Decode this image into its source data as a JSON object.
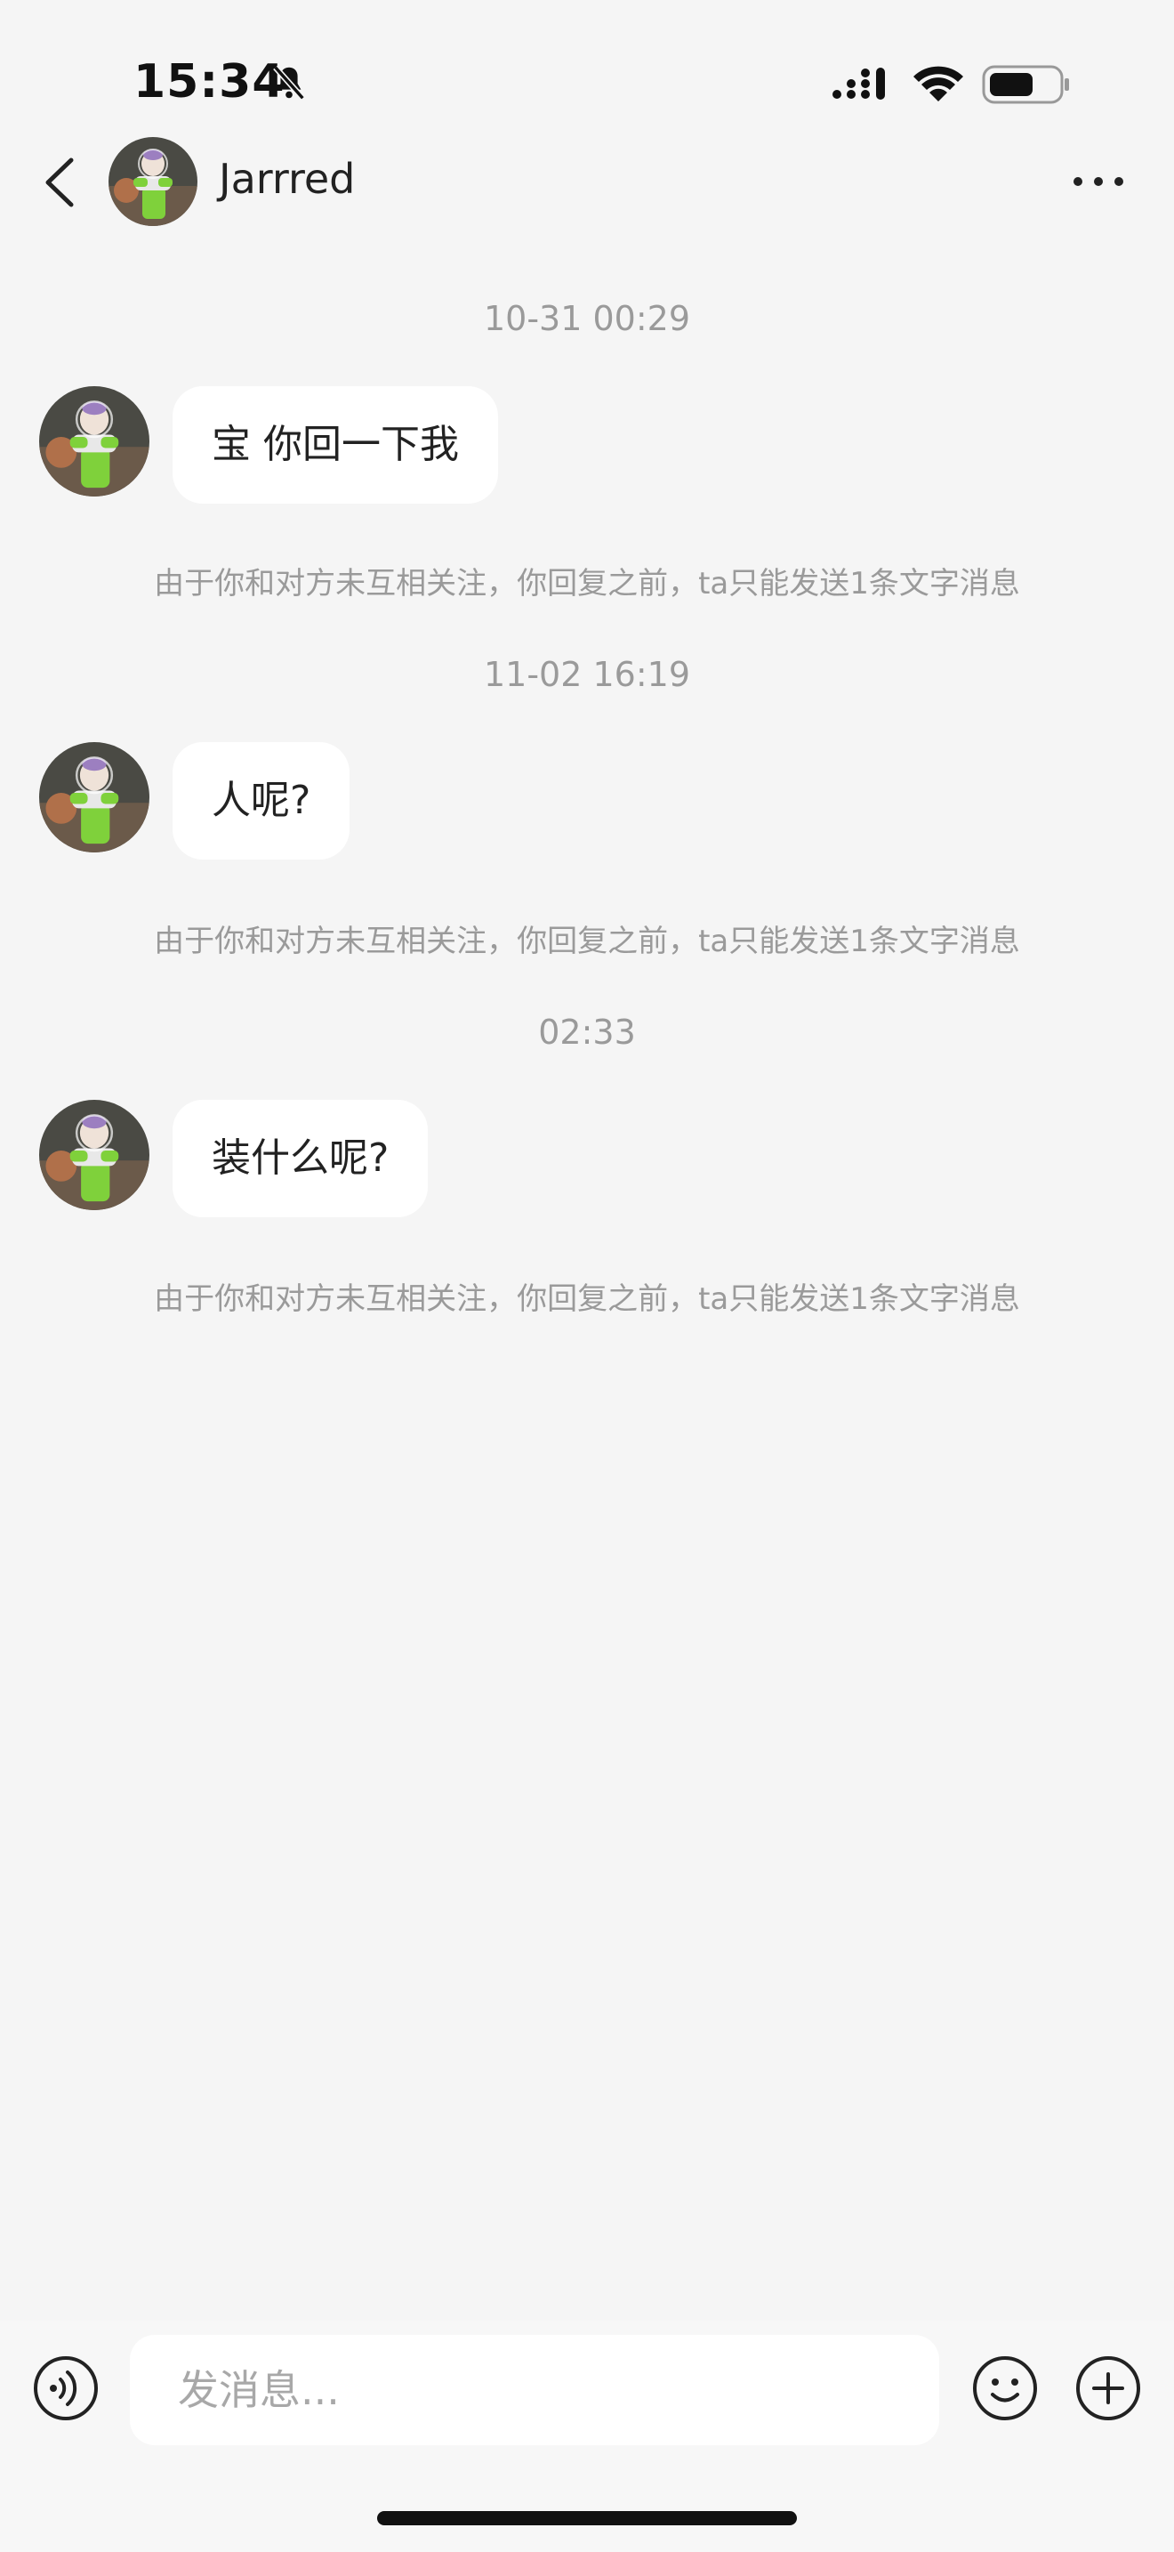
{
  "status_bar": {
    "time": "15:34",
    "icons": [
      "bell-slash-icon",
      "cellular-signal-icon",
      "wifi-icon",
      "battery-icon"
    ]
  },
  "header": {
    "back_icon": "chevron-left-icon",
    "contact_name": "Jarrred",
    "more_icon": "ellipsis-icon"
  },
  "messages": [
    {
      "timestamp": "10-31 00:29",
      "text": "宝 你回一下我",
      "notice": "由于你和对方未互相关注，你回复之前，ta只能发送1条文字消息"
    },
    {
      "timestamp": "11-02 16:19",
      "text": "人呢?",
      "notice": "由于你和对方未互相关注，你回复之前，ta只能发送1条文字消息"
    },
    {
      "timestamp": "02:33",
      "text": "装什么呢?",
      "notice": "由于你和对方未互相关注，你回复之前，ta只能发送1条文字消息"
    }
  ],
  "input_bar": {
    "placeholder": "发消息...",
    "value": "",
    "voice_icon": "voice-icon",
    "emoji_icon": "emoji-icon",
    "plus_icon": "plus-circle-icon"
  },
  "colors": {
    "background": "#f5f5f5",
    "bubble": "#ffffff",
    "meta_text": "#9a9a9a"
  }
}
